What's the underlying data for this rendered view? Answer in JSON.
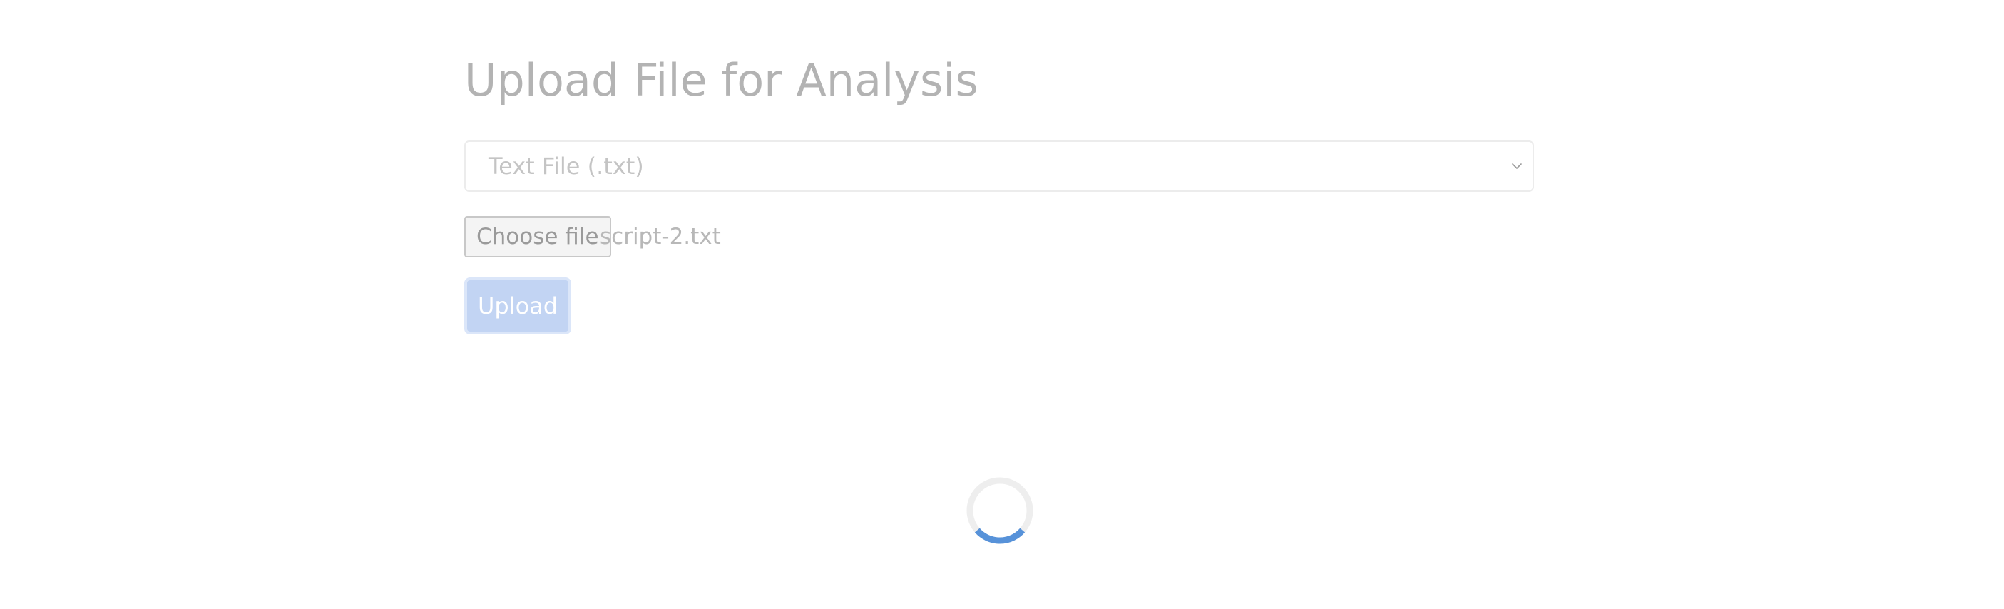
{
  "page": {
    "title": "Upload File for Analysis"
  },
  "file_type_select": {
    "selected": "Text File (.txt)",
    "icon": "chevron-down-icon"
  },
  "file_input": {
    "button_label": "Choose file",
    "file_name": "script-2.txt"
  },
  "upload_button": {
    "label": "Upload"
  },
  "loading": {
    "icon": "loading-spinner-icon"
  },
  "colors": {
    "title": "#b3b3b3",
    "upload_button_bg": "#c2d4f3",
    "spinner_track": "#eeeeee",
    "spinner_accent": "#5792d9"
  }
}
